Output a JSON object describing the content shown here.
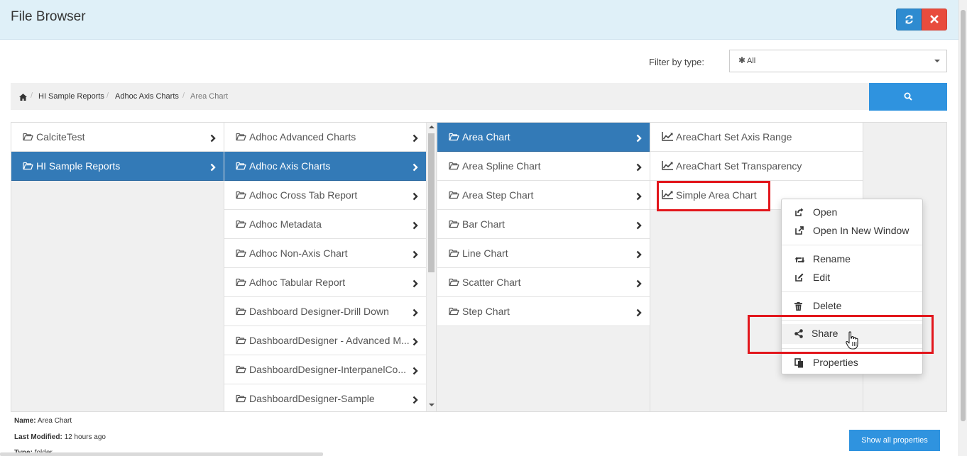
{
  "header": {
    "title": "File Browser"
  },
  "filter": {
    "label": "Filter by type:",
    "value": "All"
  },
  "breadcrumb": [
    "HI Sample Reports",
    "Adhoc Axis Charts",
    "Area Chart"
  ],
  "columns": {
    "c1": [
      {
        "label": "CalciteTest",
        "active": false
      },
      {
        "label": "HI Sample Reports",
        "active": true
      }
    ],
    "c2": [
      {
        "label": "Adhoc Advanced Charts",
        "active": false
      },
      {
        "label": "Adhoc Axis Charts",
        "active": true
      },
      {
        "label": "Adhoc Cross Tab Report",
        "active": false
      },
      {
        "label": "Adhoc Metadata",
        "active": false
      },
      {
        "label": "Adhoc Non-Axis Chart",
        "active": false
      },
      {
        "label": "Adhoc Tabular Report",
        "active": false
      },
      {
        "label": "Dashboard Designer-Drill Down",
        "active": false
      },
      {
        "label": "DashboardDesigner - Advanced M...",
        "active": false
      },
      {
        "label": "DashboardDesigner-InterpanelCo...",
        "active": false
      },
      {
        "label": "DashboardDesigner-Sample",
        "active": false
      }
    ],
    "c3": [
      {
        "label": "Area Chart",
        "active": true
      },
      {
        "label": "Area Spline Chart",
        "active": false
      },
      {
        "label": "Area Step Chart",
        "active": false
      },
      {
        "label": "Bar Chart",
        "active": false
      },
      {
        "label": "Line Chart",
        "active": false
      },
      {
        "label": "Scatter Chart",
        "active": false
      },
      {
        "label": "Step Chart",
        "active": false
      }
    ],
    "c4": [
      {
        "label": "AreaChart Set Axis Range"
      },
      {
        "label": "AreaChart Set Transparency"
      },
      {
        "label": "Simple Area Chart"
      }
    ]
  },
  "context_menu": {
    "open": "Open",
    "open_new_window": "Open In New Window",
    "rename": "Rename",
    "edit": "Edit",
    "delete": "Delete",
    "share": "Share",
    "properties": "Properties"
  },
  "info": {
    "name_label": "Name:",
    "name_value": "Area Chart",
    "modified_label": "Last Modified:",
    "modified_value": "12 hours ago",
    "type_label": "Type:",
    "type_value": "folder"
  },
  "show_all_label": "Show all properties"
}
